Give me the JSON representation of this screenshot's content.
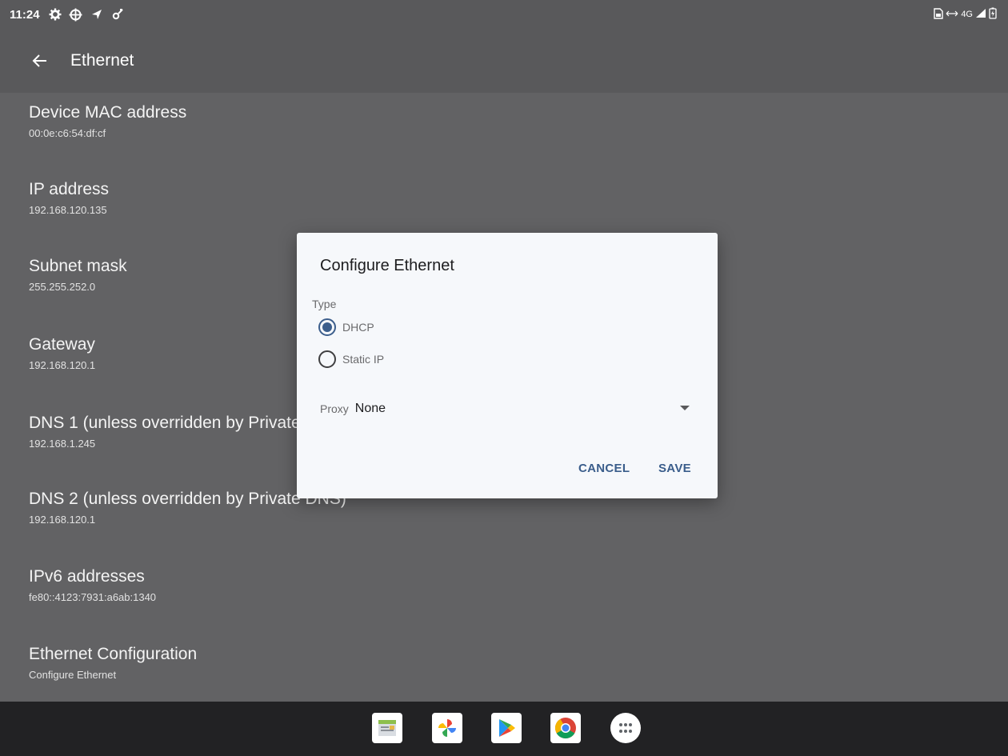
{
  "status_bar": {
    "time": "11:24",
    "left_icons": [
      "settings-gear-icon",
      "crosshair-icon",
      "location-arrow-icon",
      "tools-icon"
    ],
    "network_label": "4G"
  },
  "app_bar": {
    "title": "Ethernet"
  },
  "settings": [
    {
      "title": "Device MAC address",
      "summary": "00:0e:c6:54:df:cf"
    },
    {
      "title": "IP address",
      "summary": "192.168.120.135"
    },
    {
      "title": "Subnet mask",
      "summary": "255.255.252.0"
    },
    {
      "title": "Gateway",
      "summary": "192.168.120.1"
    },
    {
      "title": "DNS 1 (unless overridden by Private DNS)",
      "summary": "192.168.1.245"
    },
    {
      "title": "DNS 2 (unless overridden by Private DNS)",
      "summary": "192.168.120.1"
    },
    {
      "title": "IPv6 addresses",
      "summary": "fe80::4123:7931:a6ab:1340"
    },
    {
      "title": "Ethernet Configuration",
      "summary": "Configure Ethernet"
    }
  ],
  "dialog": {
    "title": "Configure Ethernet",
    "type_label": "Type",
    "options": [
      {
        "label": "DHCP",
        "checked": true
      },
      {
        "label": "Static IP",
        "checked": false
      }
    ],
    "proxy_label": "Proxy",
    "proxy_value": "None",
    "cancel_label": "CANCEL",
    "save_label": "SAVE"
  },
  "dock": [
    "notes-app-icon",
    "photos-app-icon",
    "play-store-icon",
    "chrome-icon",
    "app-drawer-icon"
  ],
  "colors": {
    "scrim_background": "#626264",
    "dialog_background": "#f6f8fb",
    "accent": "#3a5d8b",
    "navbar": "#222224"
  }
}
